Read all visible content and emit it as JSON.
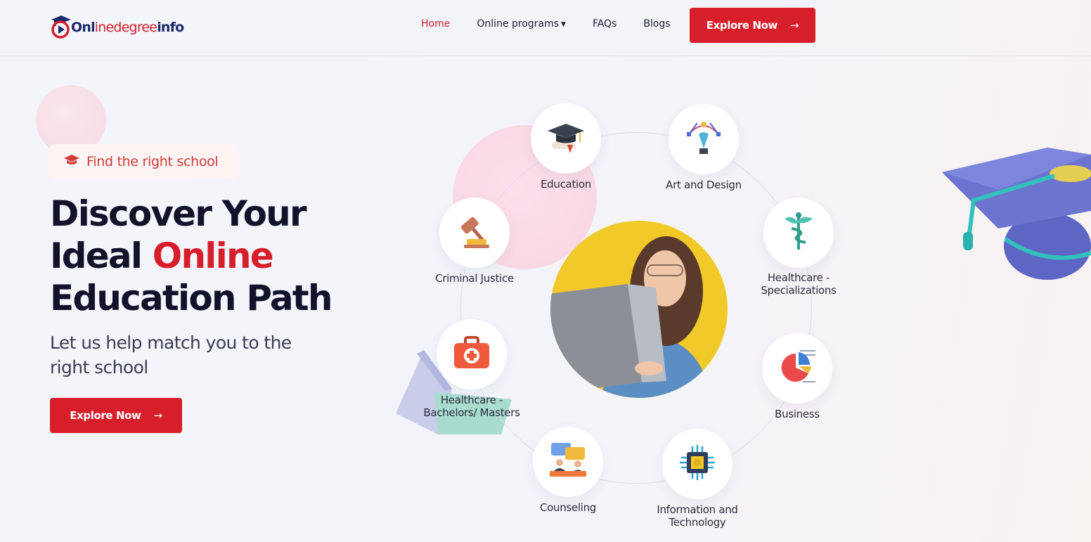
{
  "logo": {
    "part1": "Onl",
    "part2": "inedegree",
    "part3": "info"
  },
  "nav": {
    "home": "Home",
    "online_programs": "Online programs",
    "faqs": "FAQs",
    "blogs": "Blogs"
  },
  "header_button": {
    "label": "Explore Now",
    "arrow": "→"
  },
  "hero": {
    "badge": "Find the right school",
    "title_line1": "Discover Your",
    "title_line2_a": "Ideal ",
    "title_line2_b": "Online",
    "title_line3": "Education Path",
    "subtitle": "Let us help match you to the right school",
    "button": "Explore Now",
    "button_arrow": "→"
  },
  "categories": [
    {
      "label": "Education",
      "icon": "graduation-cap-icon"
    },
    {
      "label": "Art and Design",
      "icon": "pen-tool-icon"
    },
    {
      "label": "Criminal Justice",
      "icon": "gavel-icon"
    },
    {
      "label": "Healthcare -\nSpecializations",
      "icon": "caduceus-icon"
    },
    {
      "label": "Healthcare -\nBachelors/ Masters",
      "icon": "first-aid-kit-icon"
    },
    {
      "label": "Business",
      "icon": "pie-chart-icon"
    },
    {
      "label": "Counseling",
      "icon": "chat-bubbles-icon"
    },
    {
      "label": "Information and\nTechnology",
      "icon": "microchip-icon"
    }
  ],
  "colors": {
    "brand_red": "#d71f2b",
    "brand_navy": "#1d2a6b",
    "accent_yellow": "#f1c928"
  }
}
